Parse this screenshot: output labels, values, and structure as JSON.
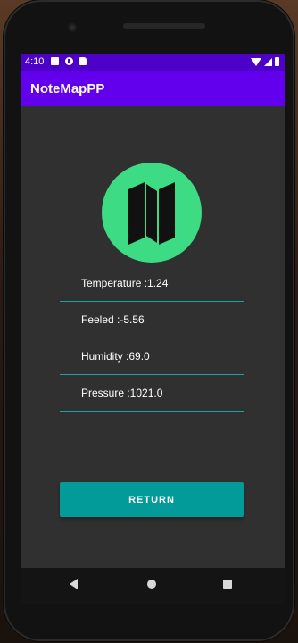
{
  "status_bar": {
    "time": "4:10"
  },
  "app_bar": {
    "title": "NoteMapPP"
  },
  "weather": {
    "temperature": "Temperature :1.24",
    "feeled": "Feeled :-5.56",
    "humidity": "Humidity :69.0",
    "pressure": "Pressure :1021.0"
  },
  "actions": {
    "return_label": "RETURN"
  },
  "colors": {
    "status_bar": "#4d00c8",
    "app_bar": "#6200ee",
    "logo_circle": "#3ddc84",
    "accent_teal": "#029b99",
    "background": "#303030"
  },
  "icons": {
    "logo": "folded-map-icon",
    "nav_back": "back-triangle-icon",
    "nav_home": "home-circle-icon",
    "nav_recents": "recents-square-icon"
  }
}
